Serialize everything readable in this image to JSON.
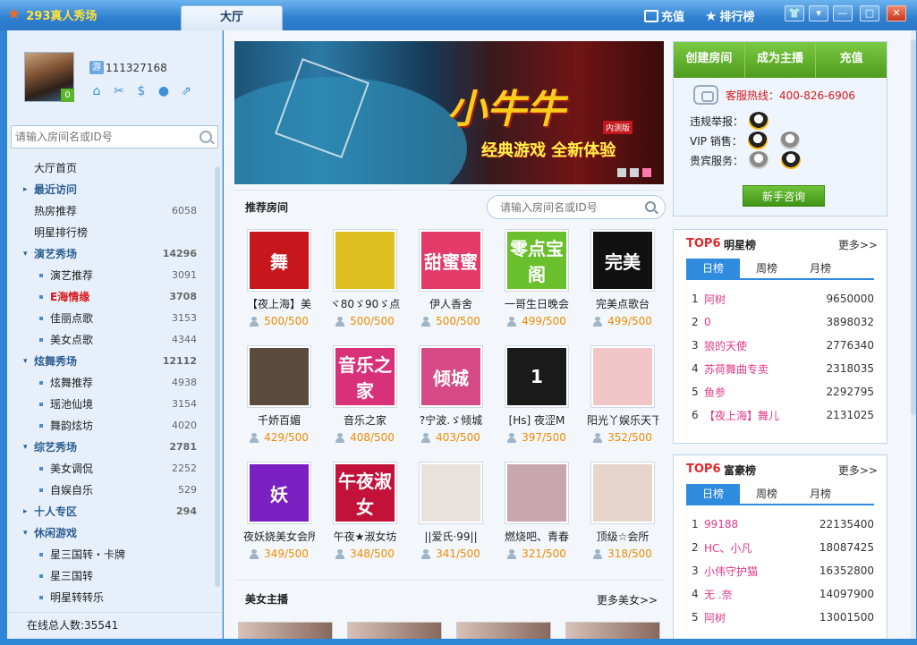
{
  "titlebar": {
    "app_title": "293真人秀场",
    "active_tab": "大厅",
    "recharge": "充值",
    "ranking": "排行榜"
  },
  "profile": {
    "uid": "111327168",
    "level": "0",
    "uid_badge": "游"
  },
  "left_search": {
    "placeholder": "请输入房间名或ID号"
  },
  "nav": [
    {
      "label": "大厅首页",
      "count": "",
      "kind": "lv0"
    },
    {
      "label": "最近访问",
      "count": "",
      "kind": "grp",
      "arrow": "▸"
    },
    {
      "label": "热房推荐",
      "count": "6058",
      "kind": "lv0"
    },
    {
      "label": "明星排行榜",
      "count": "",
      "kind": "lv0"
    },
    {
      "label": "演艺秀场",
      "count": "14296",
      "kind": "grp",
      "arrow": "▾"
    },
    {
      "label": "演艺推荐",
      "count": "3091",
      "kind": "sub"
    },
    {
      "label": "E海情缘",
      "count": "3708",
      "kind": "sub hot"
    },
    {
      "label": "佳丽点歌",
      "count": "3153",
      "kind": "sub"
    },
    {
      "label": "美女点歌",
      "count": "4344",
      "kind": "sub"
    },
    {
      "label": "炫舞秀场",
      "count": "12112",
      "kind": "grp",
      "arrow": "▾"
    },
    {
      "label": "炫舞推荐",
      "count": "4938",
      "kind": "sub"
    },
    {
      "label": "瑶池仙境",
      "count": "3154",
      "kind": "sub"
    },
    {
      "label": "舞韵炫坊",
      "count": "4020",
      "kind": "sub"
    },
    {
      "label": "综艺秀场",
      "count": "2781",
      "kind": "grp",
      "arrow": "▾"
    },
    {
      "label": "美女调侃",
      "count": "2252",
      "kind": "sub"
    },
    {
      "label": "自娱自乐",
      "count": "529",
      "kind": "sub"
    },
    {
      "label": "十人专区",
      "count": "294",
      "kind": "grp",
      "arrow": "▸"
    },
    {
      "label": "休闲游戏",
      "count": "",
      "kind": "grp",
      "arrow": "▾"
    },
    {
      "label": "星三国转・卡牌",
      "count": "",
      "kind": "sub"
    },
    {
      "label": "星三国转",
      "count": "",
      "kind": "sub"
    },
    {
      "label": "明星转转乐",
      "count": "",
      "kind": "sub"
    }
  ],
  "online": "在线总人数:35541",
  "banner": {
    "title": "小牛牛",
    "slogan": "经典游戏  全新体验",
    "badge": "内测版"
  },
  "recommended": {
    "title": "推荐房间",
    "search_placeholder": "请输入房间名或ID号"
  },
  "rooms": [
    {
      "name": "【夜上海】美",
      "count": "500/500",
      "thumb_text": "舞",
      "color": "#c8161d"
    },
    {
      "name": "ヾ80ゞ90ゞ点",
      "count": "500/500",
      "thumb_text": "",
      "color": "#e0c020"
    },
    {
      "name": "伊人香舍",
      "count": "500/500",
      "thumb_text": "甜蜜蜜",
      "color": "#e33a6a"
    },
    {
      "name": "一哥生日晚会",
      "count": "499/500",
      "thumb_text": "零点宝阁",
      "color": "#6abf2c"
    },
    {
      "name": "完美点歌台",
      "count": "499/500",
      "thumb_text": "完美",
      "color": "#111"
    },
    {
      "name": "千娇百媚",
      "count": "429/500",
      "thumb_text": "",
      "color": "#5b4a3e"
    },
    {
      "name": "音乐之家",
      "count": "408/500",
      "thumb_text": "音乐之家",
      "color": "#d9307a"
    },
    {
      "name": "?宁波.ゞ倾城",
      "count": "403/500",
      "thumb_text": "倾城",
      "color": "#d64a86"
    },
    {
      "name": "[Hs] 夜涩M",
      "count": "397/500",
      "thumb_text": "1",
      "color": "#1a1a1a"
    },
    {
      "name": "阳光丫娱乐天下",
      "count": "352/500",
      "thumb_text": "",
      "color": "#f0c6c8"
    },
    {
      "name": "夜妖娆美女会所",
      "count": "349/500",
      "thumb_text": "妖",
      "color": "#7a1fc0"
    },
    {
      "name": "午夜★淑女坊",
      "count": "348/500",
      "thumb_text": "午夜淑女",
      "color": "#c2123a"
    },
    {
      "name": "||爱氏·99||",
      "count": "341/500",
      "thumb_text": "",
      "color": "#e8e1dc"
    },
    {
      "name": "燃烧吧、青春",
      "count": "321/500",
      "thumb_text": "",
      "color": "#c8a6b0"
    },
    {
      "name": "顶级☆会所",
      "count": "318/500",
      "thumb_text": "",
      "color": "#e7d5cc"
    }
  ],
  "beauty": {
    "title": "美女主播",
    "more": "更多美女>>"
  },
  "right": {
    "actions": [
      "创建房间",
      "成为主播",
      "充值"
    ],
    "hotline": "客服热线：400-826-6906",
    "report": "违规举报：",
    "vip": "VIP 销售：",
    "vipsvc": "贵宾服务：",
    "newbie": "新手咨询"
  },
  "star_rank": {
    "top": "TOP6",
    "title": "明星榜",
    "more": "更多>>",
    "tabs": [
      "日榜",
      "周榜",
      "月榜"
    ],
    "rows": [
      {
        "no": "1",
        "name": "阿树",
        "score": "9650000"
      },
      {
        "no": "2",
        "name": "0",
        "score": "3898032"
      },
      {
        "no": "3",
        "name": "狼的天使",
        "score": "2776340"
      },
      {
        "no": "4",
        "name": "苏荷舞曲专卖",
        "score": "2318035"
      },
      {
        "no": "5",
        "name": "鱼参",
        "score": "2292795"
      },
      {
        "no": "6",
        "name": "【夜上海】舞儿",
        "score": "2131025"
      }
    ]
  },
  "rich_rank": {
    "top": "TOP6",
    "title": "富豪榜",
    "more": "更多>>",
    "tabs": [
      "日榜",
      "周榜",
      "月榜"
    ],
    "rows": [
      {
        "no": "1",
        "name": "99188",
        "score": "22135400"
      },
      {
        "no": "2",
        "name": "HC、小凡",
        "score": "18087425"
      },
      {
        "no": "3",
        "name": "小伟守护猫",
        "score": "16352800"
      },
      {
        "no": "4",
        "name": "无 .奈",
        "score": "14097900"
      },
      {
        "no": "5",
        "name": "阿树",
        "score": "13001500"
      }
    ]
  }
}
